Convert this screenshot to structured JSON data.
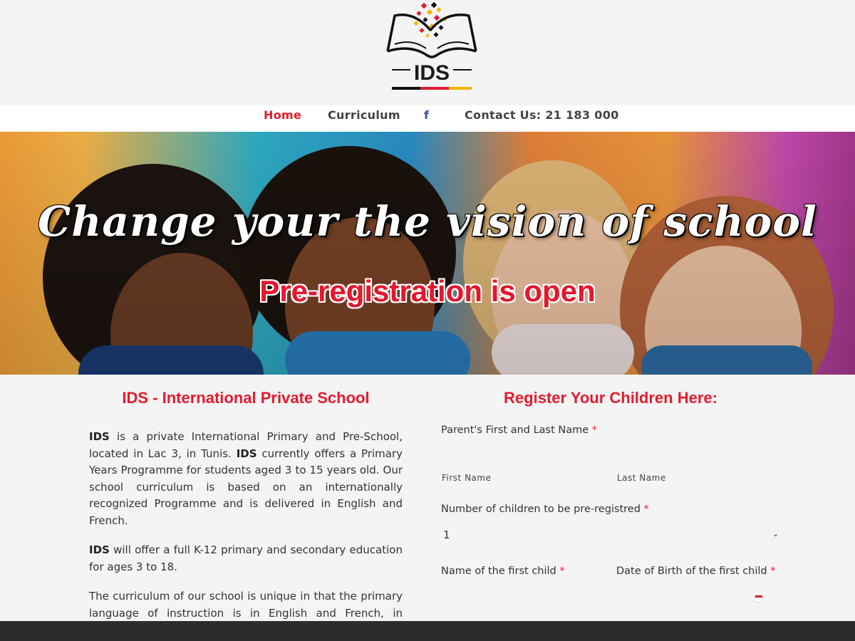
{
  "logo": {
    "text": "IDS"
  },
  "nav": {
    "home": "Home",
    "curriculum": "Curriculum",
    "facebook_icon": "f",
    "contact": "Contact Us: 21 183 000"
  },
  "hero": {
    "title": "Change your the vision of school",
    "subtitle": "Pre-registration is open"
  },
  "about": {
    "title": "IDS - International Private School",
    "p1_brand": "IDS",
    "p1_a": " is a private International Primary and Pre-School, located in Lac 3, in Tunis. ",
    "p1_brand2": "IDS",
    "p1_b": " currently offers a Primary Years Programme for students aged 3 to 15 years old. Our school curriculum is based on an internationally recognized Programme and is delivered in English and French.",
    "p2_brand": "IDS",
    "p2_a": " will offer a full K-12 primary and secondary education for ages 3 to 18.",
    "p3": "The curriculum of our school is unique in that the primary language of instruction is in English and French, in addition to a strong emphasis on teaching the German language and culture."
  },
  "form": {
    "title": "Register Your Children Here:",
    "parent_label": "Parent's First and Last Name",
    "required_mark": "*",
    "first_name": "First Name",
    "last_name": "Last Name",
    "children_label": "Number of children to be pre-registred",
    "children_value": "1",
    "child_name_label": "Name of the first child",
    "child_dob_label": "Date of Birth of the first child"
  },
  "colors": {
    "accent": "#e31c2f",
    "nav_text": "#444444",
    "footer": "#2c2c2c"
  }
}
